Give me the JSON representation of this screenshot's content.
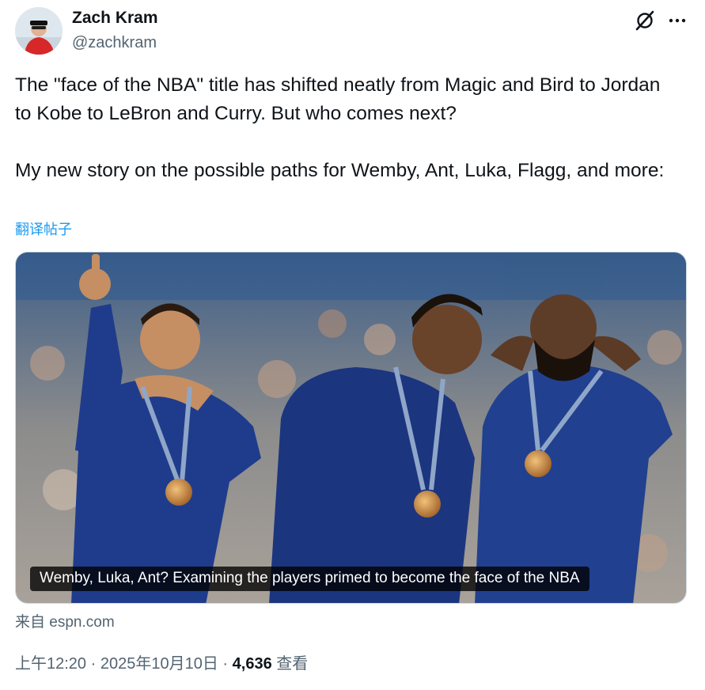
{
  "author": {
    "name": "Zach Kram",
    "handle": "@zachkram"
  },
  "icons": {
    "grok": "grok-slash-icon",
    "more": "more-horizontal-icon"
  },
  "tweet": {
    "text": "The \"face of the NBA\" title has shifted neatly from Magic and Bird to Jordan to Kobe to LeBron and Curry. But who comes next?\n\nMy new story on the possible paths for Wemby, Ant, Luka, Flagg, and more:",
    "translate_label": "翻译帖子"
  },
  "card": {
    "caption": "Wemby, Luka, Ant? Examining the players primed to become the face of the NBA",
    "source": "来自 espn.com"
  },
  "meta": {
    "time": "上午12:20",
    "separator": "·",
    "date": "2025年10月10日",
    "views_count": "4,636",
    "views_label": "查看"
  },
  "colors": {
    "text": "#0f1419",
    "secondary": "#536471",
    "link": "#1d9bf0",
    "jersey": "#1f3c8c"
  }
}
